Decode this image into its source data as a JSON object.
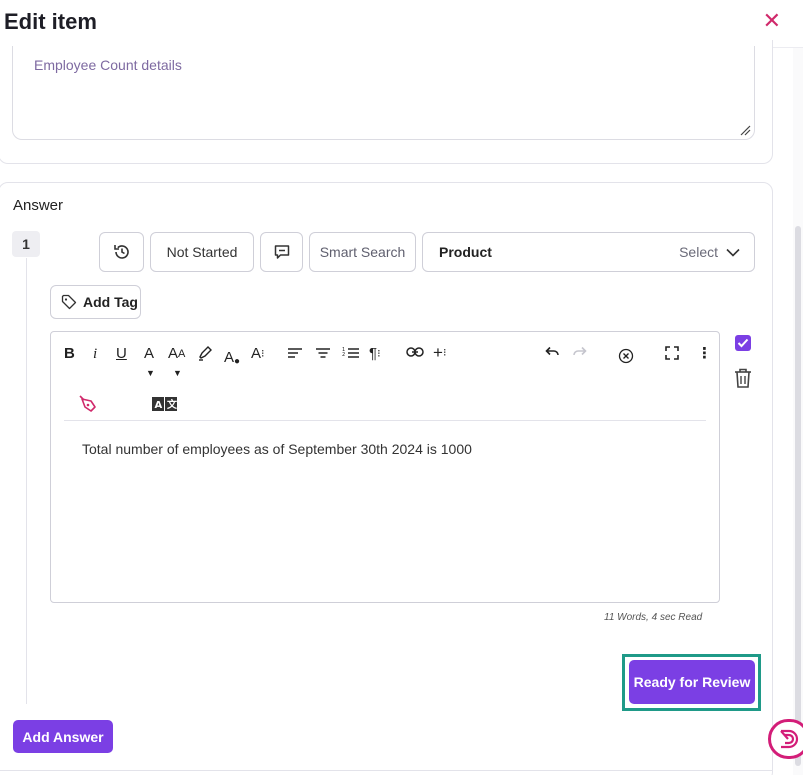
{
  "header": {
    "title": "Edit item",
    "close_icon": "close-icon"
  },
  "description": {
    "value": "Employee Count details"
  },
  "answer": {
    "section_label": "Answer",
    "index": "1",
    "toolbar": {
      "history_icon": "history-icon",
      "status_label": "Not Started",
      "comment_icon": "comment-icon",
      "smart_search_label": "Smart Search",
      "product_label": "Product",
      "product_select_placeholder": "Select"
    },
    "add_tag_label": "Add Tag",
    "editor": {
      "tools": [
        "bold",
        "italic",
        "underline",
        "font-color",
        "font-size",
        "highlight",
        "text-color-fill",
        "text-style",
        "align-left",
        "align-center",
        "ordered-list",
        "paragraph-format",
        "link",
        "insert-more",
        "undo",
        "redo",
        "clear-formatting",
        "fullscreen",
        "more-options",
        "ai-pen",
        "translate"
      ],
      "content": "Total number of employees as of September 30th 2024 is 1000"
    },
    "word_count": "11 Words, 4 sec Read",
    "ready_for_review_label": "Ready for Review"
  },
  "add_answer_label": "Add Answer",
  "colors": {
    "accent": "#7b3fe4",
    "close": "#d0296b",
    "highlight": "#1f9a88",
    "assistant": "#d31d78"
  }
}
